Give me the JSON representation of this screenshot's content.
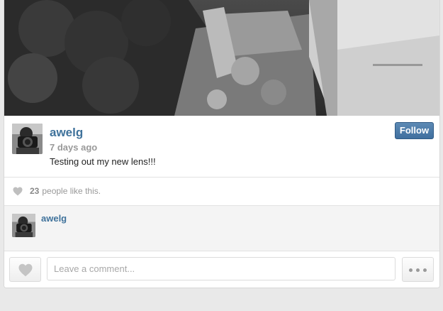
{
  "post": {
    "photo_icon": "photo-grayscale",
    "user": {
      "username": "awelg",
      "avatar_icon": "camera-portrait-avatar"
    },
    "timestamp": "7 days ago",
    "caption": "Testing out my new lens!!!",
    "follow_label": "Follow",
    "likes": {
      "count": "23",
      "text": "people like this."
    },
    "comments": [
      {
        "username": "awelg"
      }
    ],
    "comment_bar": {
      "placeholder": "Leave a comment..."
    }
  },
  "colors": {
    "link": "#3f729b",
    "follow_button": "#4a7cab",
    "muted_text": "#999999"
  }
}
